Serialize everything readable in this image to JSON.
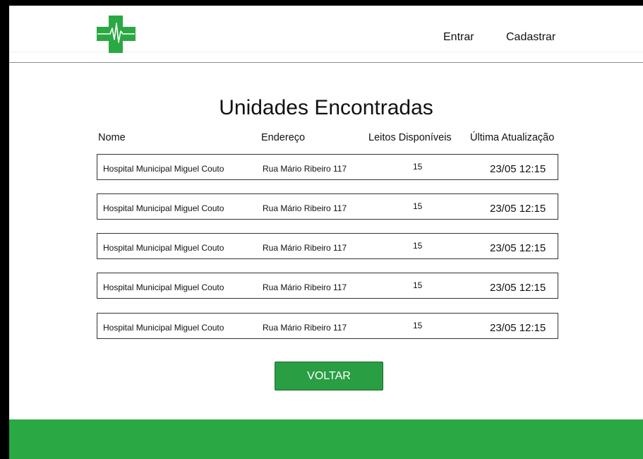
{
  "colors": {
    "brand_green": "#2aa843",
    "button_green": "#2a9e43"
  },
  "header": {
    "logo_icon": "medical-cross-pulse-icon",
    "nav": {
      "login_label": "Entrar",
      "signup_label": "Cadastrar"
    }
  },
  "main": {
    "title": "Unidades Encontradas",
    "columns": {
      "nome": "Nome",
      "endereco": "Endereço",
      "leitos": "Leitos Disponíveis",
      "atualizacao": "Última Atualização"
    },
    "rows": [
      {
        "nome": "Hospital Municipal Miguel Couto",
        "endereco": "Rua Mário Ribeiro 117",
        "leitos": "15",
        "atualizacao": "23/05  12:15"
      },
      {
        "nome": "Hospital Municipal Miguel Couto",
        "endereco": "Rua Mário Ribeiro 117",
        "leitos": "15",
        "atualizacao": "23/05  12:15"
      },
      {
        "nome": "Hospital Municipal Miguel Couto",
        "endereco": "Rua Mário Ribeiro 117",
        "leitos": "15",
        "atualizacao": "23/05  12:15"
      },
      {
        "nome": "Hospital Municipal Miguel Couto",
        "endereco": "Rua Mário Ribeiro 117",
        "leitos": "15",
        "atualizacao": "23/05  12:15"
      },
      {
        "nome": "Hospital Municipal Miguel Couto",
        "endereco": "Rua Mário Ribeiro 117",
        "leitos": "15",
        "atualizacao": "23/05  12:15"
      }
    ],
    "back_button_label": "VOLTAR"
  }
}
